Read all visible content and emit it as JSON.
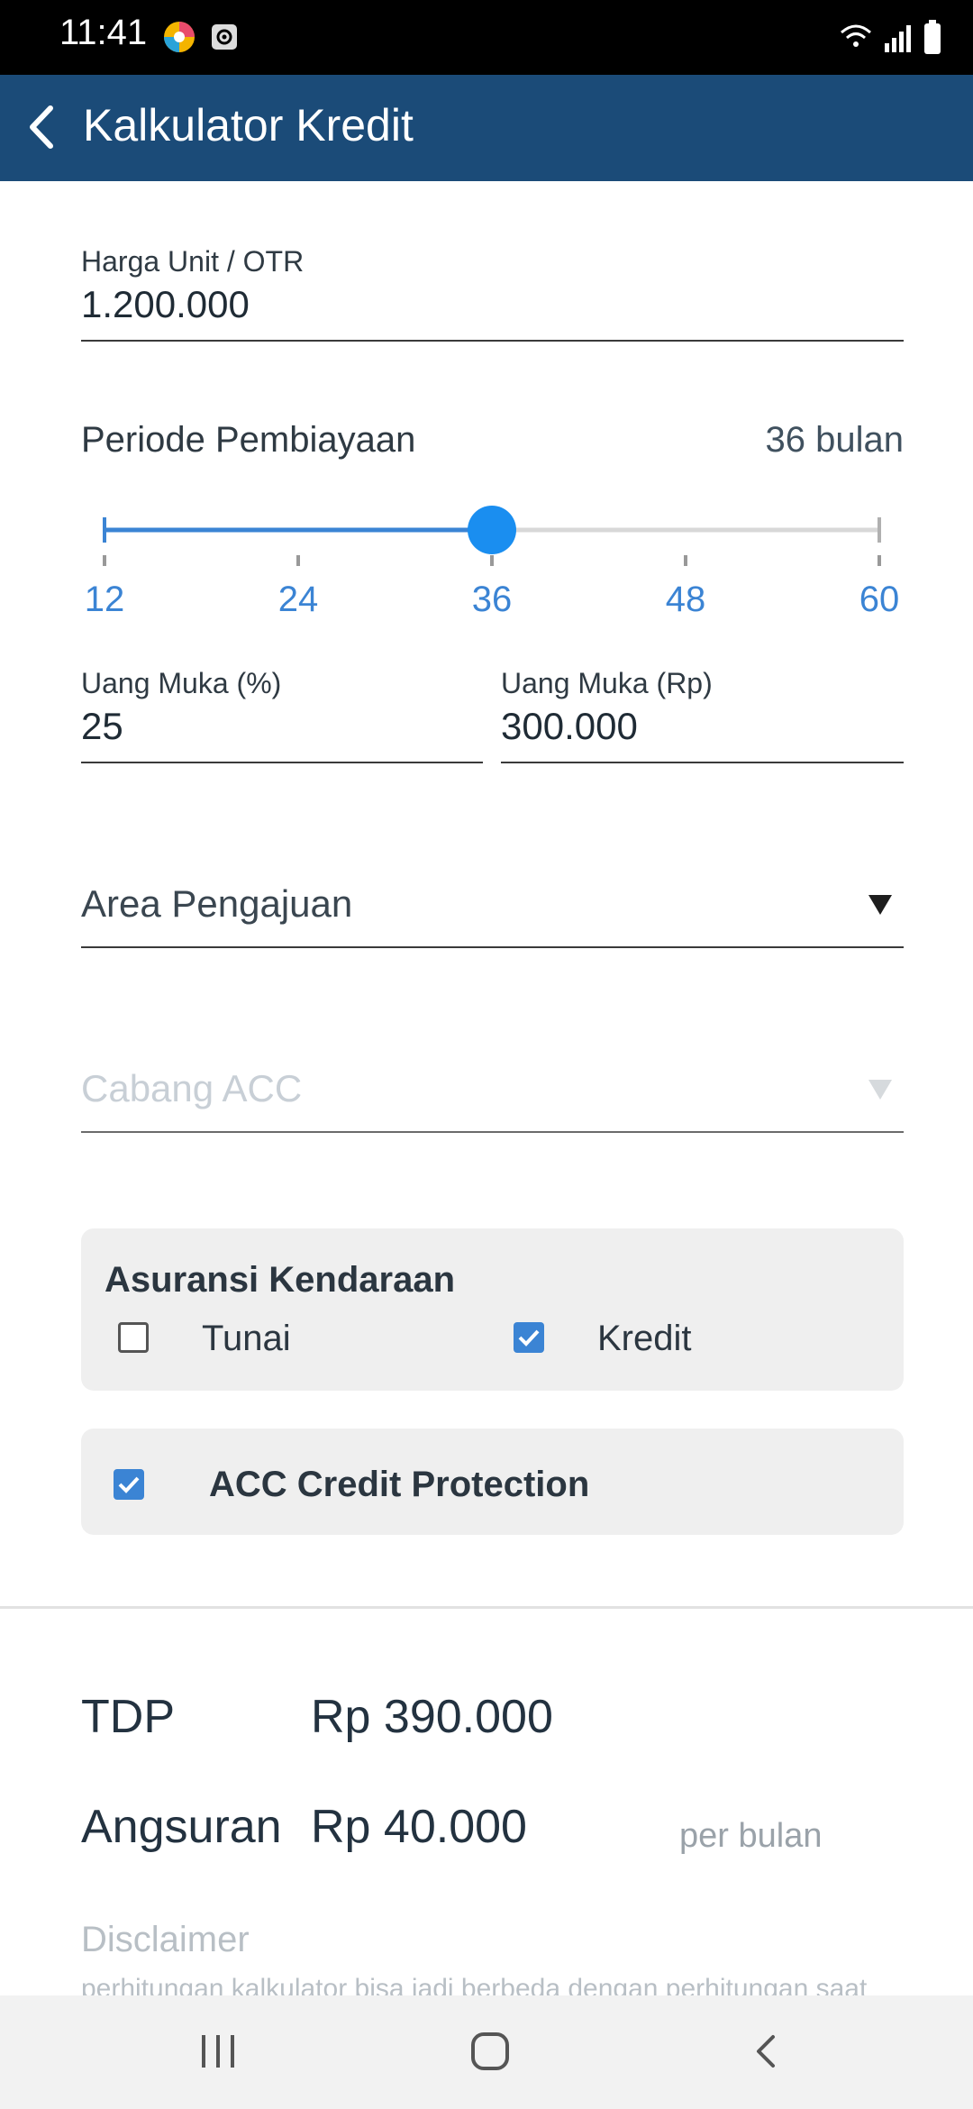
{
  "status_bar": {
    "time": "11:41",
    "icons": [
      "app-colorful-icon",
      "screen-record-icon",
      "wifi-icon",
      "signal-icon",
      "battery-icon"
    ]
  },
  "app_bar": {
    "title": "Kalkulator Kredit",
    "background": "#1b4b78"
  },
  "otr": {
    "label": "Harga Unit / OTR",
    "value": "1.200.000"
  },
  "period": {
    "label": "Periode Pembiayaan",
    "value_text": "36 bulan",
    "slider": {
      "min": 12,
      "max": 60,
      "value": 36,
      "ticks": [
        "12",
        "24",
        "36",
        "48",
        "60"
      ],
      "accent": "#3b84d4"
    }
  },
  "down_payment": {
    "percent_label": "Uang Muka (%)",
    "percent_value": "25",
    "amount_label": "Uang Muka (Rp)",
    "amount_value": "300.000"
  },
  "area": {
    "placeholder": "Area Pengajuan"
  },
  "branch": {
    "placeholder": "Cabang ACC"
  },
  "insurance": {
    "title": "Asuransi Kendaraan",
    "options": [
      {
        "label": "Tunai",
        "checked": false
      },
      {
        "label": "Kredit",
        "checked": true
      }
    ]
  },
  "protection": {
    "label": "ACC Credit Protection",
    "checked": true
  },
  "summary": {
    "tdp_label": "TDP",
    "tdp_value": "Rp 390.000",
    "installment_label": "Angsuran",
    "installment_value": "Rp 40.000",
    "installment_unit": "per bulan"
  },
  "disclaimer": {
    "title": "Disclaimer",
    "text": "perhitungan kalkulator bisa jadi berbeda dengan perhitungan saat"
  },
  "nav_bar": {
    "icons": [
      "recent-apps-icon",
      "home-icon",
      "back-icon"
    ]
  }
}
